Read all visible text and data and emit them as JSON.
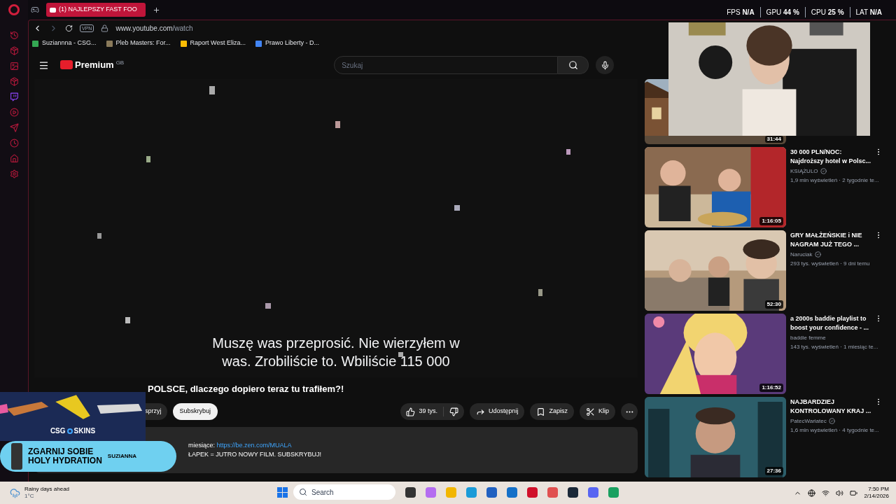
{
  "browser": {
    "tab_title": "(1) NAJLEPSZY FAST FOO",
    "vpn": "VPN",
    "url_host": "www.youtube.com",
    "url_path": "/watch",
    "bookmarks": [
      {
        "label": "Suziannna - CSG...",
        "color": "#34a853"
      },
      {
        "label": "Pleb Masters: For...",
        "color": "#8a7a5a"
      },
      {
        "label": "Raport West Eliza...",
        "color": "#fbbc04"
      },
      {
        "label": "Prawo Liberty - D...",
        "color": "#4285f4"
      }
    ]
  },
  "perf_overlay": [
    {
      "label": "FPS",
      "value": "N/A"
    },
    {
      "label": "GPU",
      "value": "44 %"
    },
    {
      "label": "CPU",
      "value": "25 %"
    },
    {
      "label": "LAT",
      "value": "N/A"
    }
  ],
  "youtube": {
    "logo": "Premium",
    "region": "GB",
    "search": {
      "placeholder": "Szukaj"
    },
    "captions": [
      "Muszę was przeprosić. Nie wierzyłem w",
      "was. Zrobiliście to. Wbiliście 115 000"
    ],
    "title": "POLSCE, dlaczego dopiero teraz tu trafiłem?!",
    "support_button": "sprzyj",
    "subscribe_button": "Subskrybuj",
    "actions": [
      {
        "kind": "like",
        "label": "39 tys."
      },
      {
        "kind": "share",
        "label": "Udostępnij"
      },
      {
        "kind": "save",
        "label": "Zapisz"
      },
      {
        "kind": "clip",
        "label": "Klip"
      }
    ],
    "description": [
      {
        "text": "miesiące: ",
        "link": "https://be.zen.com/MUALA"
      },
      {
        "text": "ŁAPEK = JUTRO NOWY FILM. SUBSKRYBUJ!"
      }
    ],
    "recommendations": [
      {
        "duration": "31:44"
      },
      {
        "duration": "1:16:05",
        "title": "30 000 PLN/NOC: Najdroższy hotel w Polsc...",
        "channel": "KSIĄŻULO",
        "verified": true,
        "meta": "1,9 mln wyświetleń · 2 tygodnie te..."
      },
      {
        "duration": "52:30",
        "title": "GRY MAŁŻEŃSKIE i NIE NAGRAM JUŻ TEGO ...",
        "channel": "Naruciak",
        "verified": true,
        "meta": "293 tys. wyświetleń · 9 dni temu"
      },
      {
        "duration": "1:16:52",
        "title": "a 2000s baddie playlist to boost your confidence - ...",
        "channel": "baddie femme",
        "verified": false,
        "meta": "143 tys. wyświetleń · 1 miesiąc te..."
      },
      {
        "duration": "27:36",
        "title": "NAJBARDZIEJ KONTROLOWANY KRAJ ...",
        "channel": "PatecWariatec",
        "verified": true,
        "meta": "1,6 mln wyświetleń · 4 tygodnie te..."
      }
    ]
  },
  "ad_overlay": {
    "brand_left": "CSG",
    "brand_right": "SKINS",
    "headline_1": "ZGARNIJ SOBIE",
    "headline_2": "HOLY HYDRATION",
    "code": "SUZIANNA"
  },
  "taskbar": {
    "weather": "Rainy days ahead",
    "temperature": "1°C",
    "search": "Search",
    "time": "7:50 PM",
    "date": "2/14/2026"
  }
}
